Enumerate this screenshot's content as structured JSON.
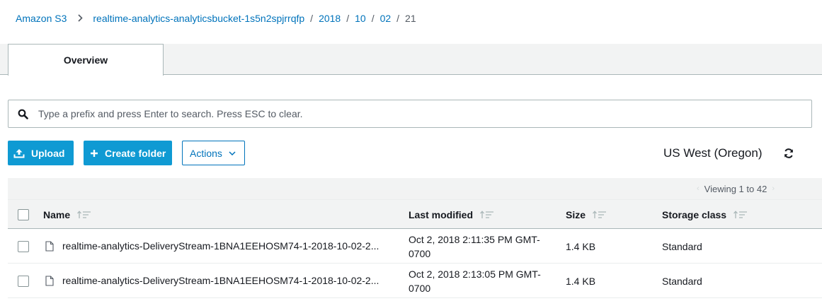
{
  "breadcrumb": {
    "root": "Amazon S3",
    "bucket": "realtime-analytics-analyticsbucket-1s5n2spjrrqfp",
    "path": [
      "2018",
      "10",
      "02"
    ],
    "current": "21",
    "separator": "/"
  },
  "tabs": [
    {
      "label": "Overview"
    }
  ],
  "search": {
    "placeholder": "Type a prefix and press Enter to search. Press ESC to clear.",
    "value": ""
  },
  "toolbar": {
    "upload_label": "Upload",
    "create_folder_label": "Create folder",
    "actions_label": "Actions",
    "region": "US West (Oregon)"
  },
  "pager": {
    "text": "Viewing 1 to 42"
  },
  "table": {
    "columns": {
      "name": "Name",
      "last_modified": "Last modified",
      "size": "Size",
      "storage_class": "Storage class"
    },
    "rows": [
      {
        "name": "realtime-analytics-DeliveryStream-1BNA1EEHOSM74-1-2018-10-02-2...",
        "last_modified": "Oct 2, 2018 2:11:35 PM GMT-0700",
        "size": "1.4 KB",
        "storage_class": "Standard"
      },
      {
        "name": "realtime-analytics-DeliveryStream-1BNA1EEHOSM74-1-2018-10-02-2...",
        "last_modified": "Oct 2, 2018 2:13:05 PM GMT-0700",
        "size": "1.4 KB",
        "storage_class": "Standard"
      }
    ]
  },
  "colors": {
    "link": "#0073bb",
    "primary_button": "#0f9ad3",
    "band": "#f2f3f3",
    "border": "#aab7b8"
  }
}
